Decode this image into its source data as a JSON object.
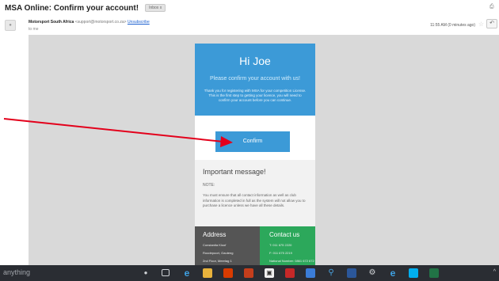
{
  "email": {
    "subject": "MSA Online: Confirm your account!",
    "folder_tag": "Inbox x",
    "sender_name": "Motorsport South Africa",
    "sender_email": "<support@motorsport.co.za>",
    "unsubscribe": "Unsubscribe",
    "to": "to me",
    "timestamp": "11:55 AM (0 minutes ago)"
  },
  "card": {
    "greeting": "Hi Joe",
    "subheading": "Please confirm your account with us!",
    "body": "Thank you for registering with MSA for your competition License. This is the first step to getting your licence, you will need to confirm your account before you can continue.",
    "confirm_button": "Confirm",
    "notice_title": "Important message!",
    "notice_label": "NOTE:",
    "notice_body": "You must ensure that all contact information as well as club information is completed in full as the system will not allow you to purchase a licence unless we have all these details.",
    "address_title": "Address",
    "address_lines": [
      "Constantia Kloof",
      "Roodepoort, Gauteng",
      "2nd Floor, Meerlag 1"
    ],
    "contact_title": "Contact us",
    "contact_lines": [
      "T: 011 675 2220",
      "F: 011 675 2219",
      "National Number: 0861 672 672"
    ]
  },
  "taskbar": {
    "search_placeholder": "anything",
    "tray": "^"
  },
  "colors": {
    "hero_blue": "#3c9ad7",
    "footer_gray": "#555555",
    "footer_green": "#2ca85b",
    "annotation_red": "#e3001b"
  },
  "icons": [
    "print-icon",
    "star-icon",
    "reply-icon",
    "task-view-icon",
    "edge-icon",
    "file-explorer-icon",
    "store-icon",
    "office-icon",
    "powerpoint-icon",
    "acrobat-icon",
    "photos-icon",
    "search-icon",
    "word-icon",
    "settings-icon",
    "skype-icon",
    "excel-icon"
  ]
}
